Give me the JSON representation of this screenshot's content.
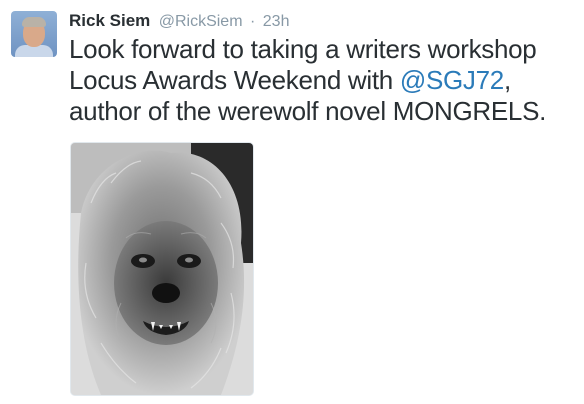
{
  "user": {
    "name": "Rick Siem",
    "handle": "@RickSiem",
    "separator": "·",
    "time": "23h"
  },
  "tweet": {
    "line1": "Look forward to taking a writers workshop",
    "line2_prefix": "Locus Awards Weekend with ",
    "line2_mention": "@SGJ72",
    "line2_suffix": ",",
    "line3": "author of the werewolf novel MONGRELS."
  },
  "colors": {
    "name": "#292f33",
    "meta": "#8899a6",
    "mention": "#2b7bb9"
  }
}
